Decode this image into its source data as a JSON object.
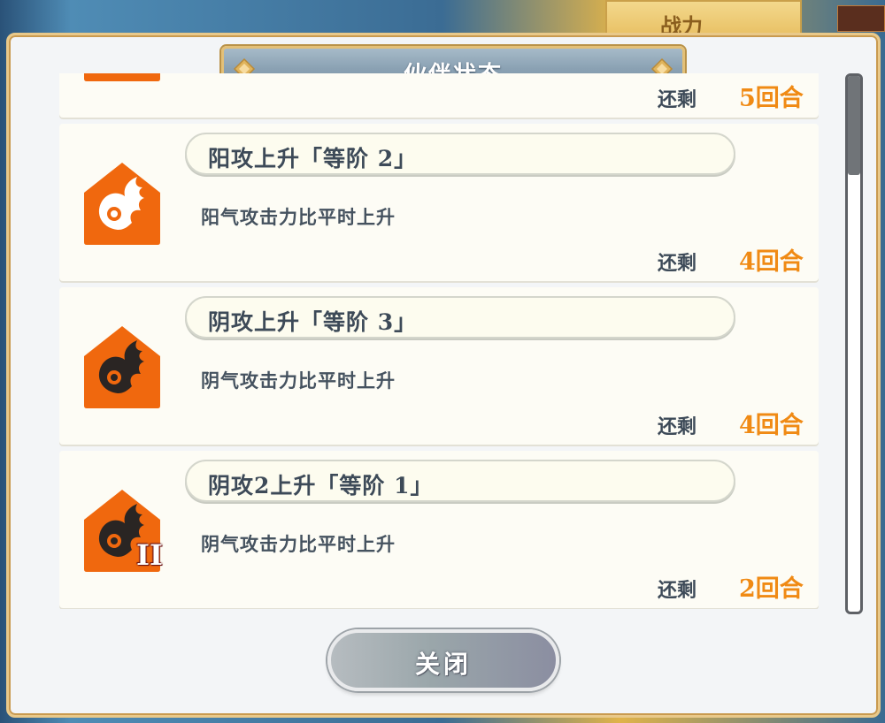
{
  "dialog": {
    "title": "伙伴状态",
    "close_label": "关闭"
  },
  "background": {
    "tab_label": "战力"
  },
  "buffs": [
    {
      "name": "",
      "description": "",
      "remain_label": "还剩",
      "remain_value": "5回合",
      "icon": "sun-bird-icon",
      "tier_badge": ""
    },
    {
      "name": "阳攻上升「等阶 2」",
      "description": "阳气攻击力比平时上升",
      "remain_label": "还剩",
      "remain_value": "4回合",
      "icon": "sun-bird-icon",
      "tier_badge": ""
    },
    {
      "name": "阴攻上升「等阶 3」",
      "description": "阴气攻击力比平时上升",
      "remain_label": "还剩",
      "remain_value": "4回合",
      "icon": "moon-bird-icon",
      "tier_badge": ""
    },
    {
      "name": "阴攻2上升「等阶 1」",
      "description": "阴气攻击力比平时上升",
      "remain_label": "还剩",
      "remain_value": "2回合",
      "icon": "moon-bird-icon",
      "tier_badge": "II"
    }
  ],
  "colors": {
    "accent_orange": "#f08a14",
    "icon_orange": "#f0680e",
    "text_dark": "#3d4a58"
  }
}
